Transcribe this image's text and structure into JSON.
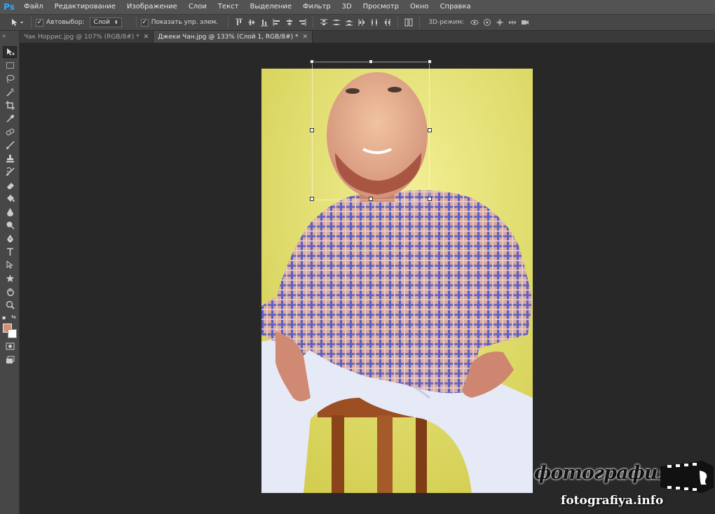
{
  "app": {
    "logo": "Ps"
  },
  "menu": [
    "Файл",
    "Редактирование",
    "Изображение",
    "Слои",
    "Текст",
    "Выделение",
    "Фильтр",
    "3D",
    "Просмотр",
    "Окно",
    "Справка"
  ],
  "options": {
    "autoselect_label": "Автовыбор:",
    "autoselect_value": "Слой",
    "show_controls_label": "Показать упр. элем.",
    "mode3d_label": "3D-режим:"
  },
  "tabs": [
    {
      "title": "Чак Норрис.jpg @ 107% (RGB/8#) *",
      "active": false
    },
    {
      "title": "Джеки Чан.jpg @ 133% (Слой 1, RGB/8#) *",
      "active": true
    }
  ],
  "colors": {
    "foreground": "#d49070",
    "background": "#ffffff",
    "canvas_bg": "#dedc6a"
  },
  "watermark": {
    "script_text": "фотография",
    "url": "fotografiya.info"
  }
}
